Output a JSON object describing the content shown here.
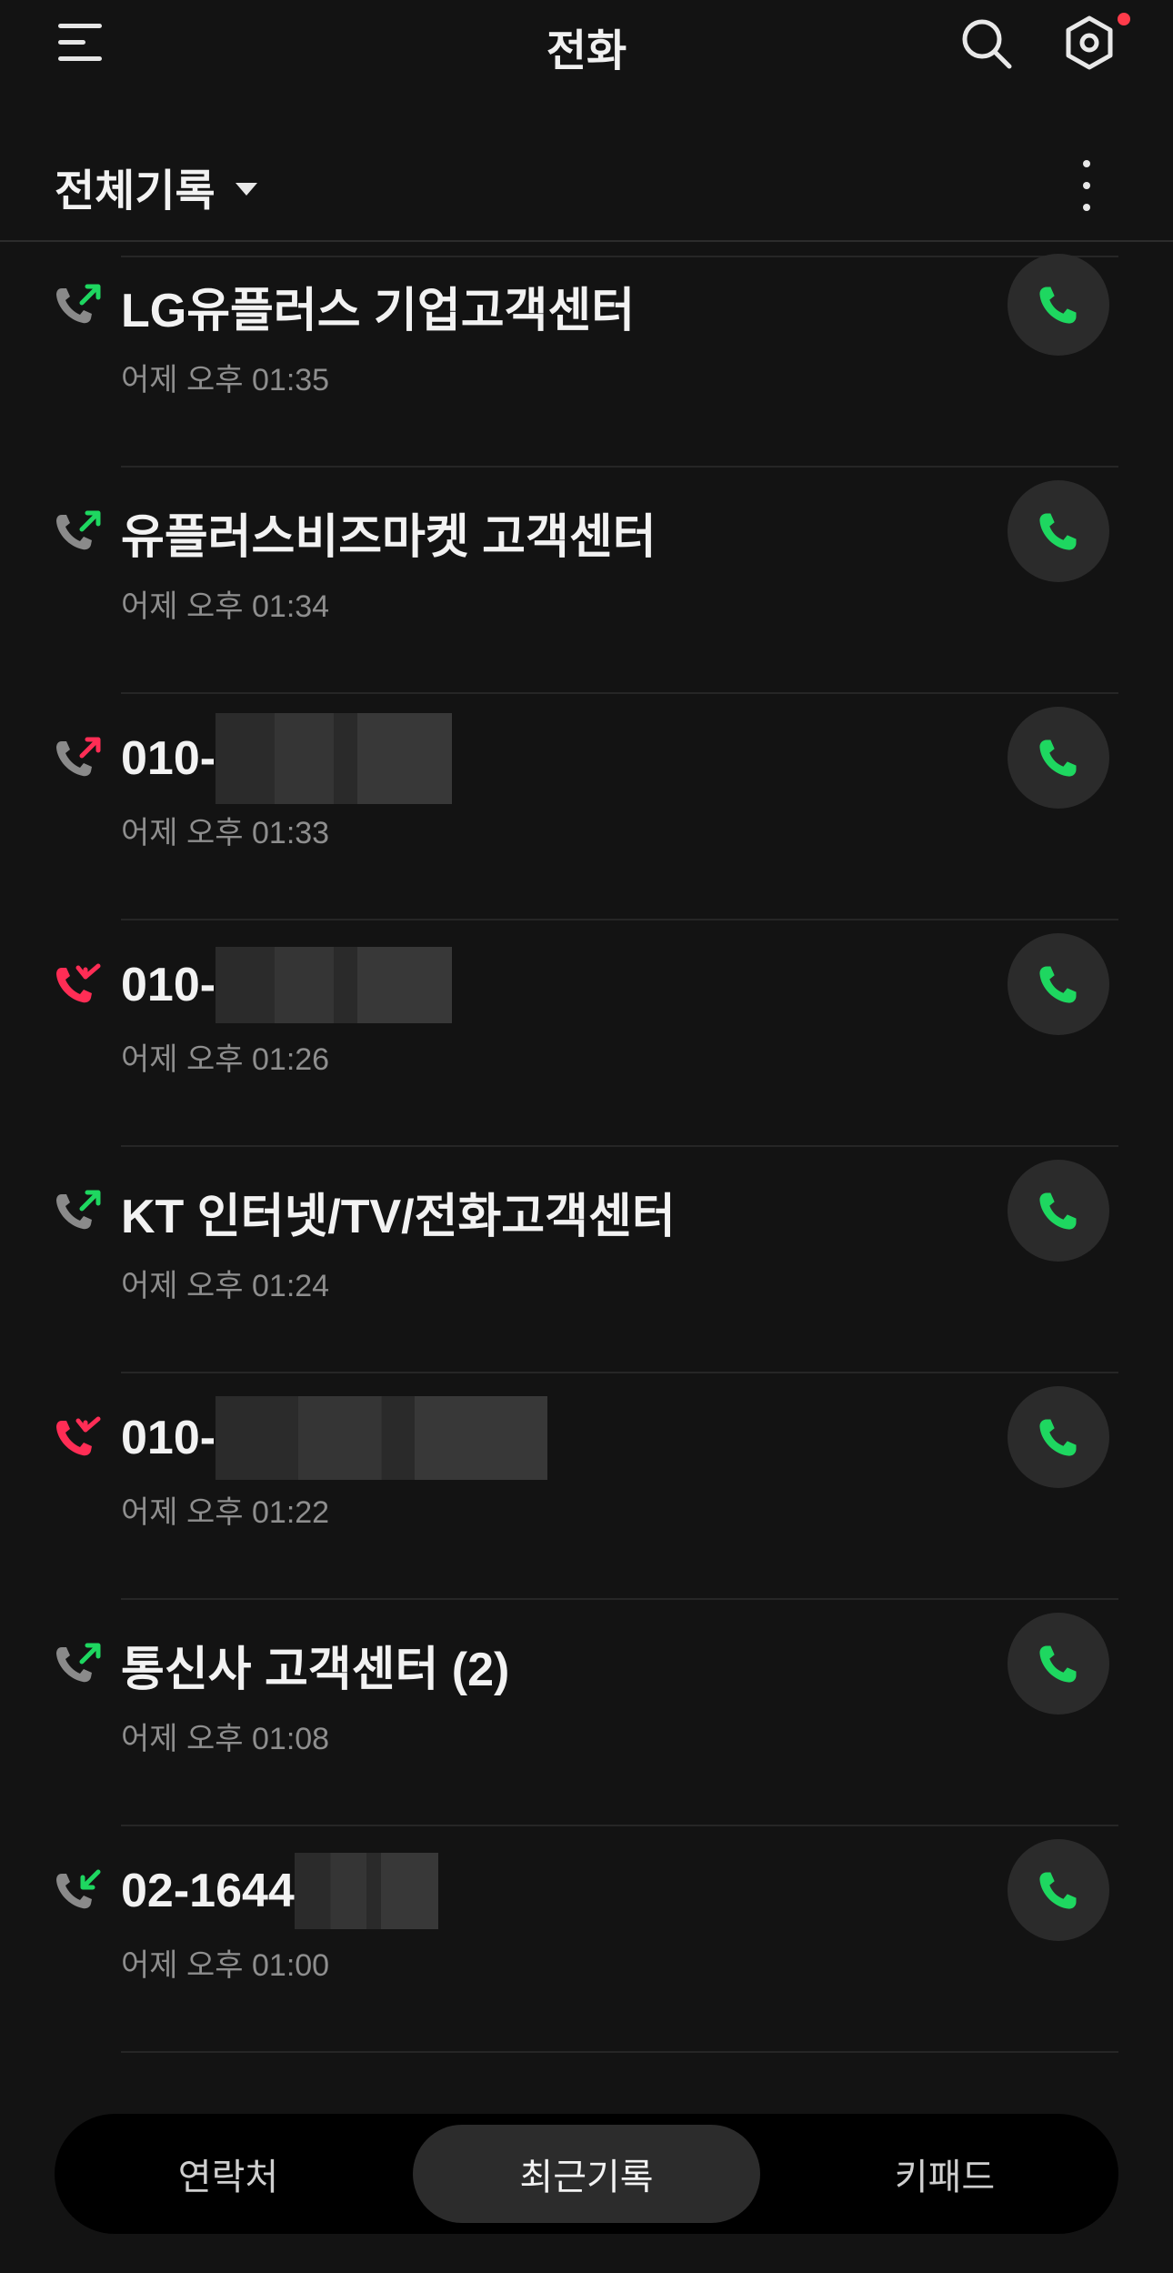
{
  "header": {
    "title": "전화"
  },
  "filter": {
    "label": "전체기록"
  },
  "calls": [
    {
      "name": "LG유플러스 기업고객센터",
      "time": "어제 오후 01:35",
      "type": "outgoing",
      "masked": false
    },
    {
      "name": "유플러스비즈마켓 고객센터",
      "time": "어제 오후 01:34",
      "type": "outgoing",
      "masked": false
    },
    {
      "name": "010-",
      "time": "어제 오후 01:33",
      "type": "outgoing-rejected",
      "masked": true
    },
    {
      "name": "010-",
      "time": "어제 오후 01:26",
      "type": "missed",
      "masked": true
    },
    {
      "name": "KT 인터넷/TV/전화고객센터",
      "time": "어제 오후 01:24",
      "type": "outgoing",
      "masked": false
    },
    {
      "name": "010-",
      "time": "어제 오후 01:22",
      "type": "missed",
      "masked": true
    },
    {
      "name": "통신사 고객센터  (2)",
      "time": "어제 오후 01:08",
      "type": "outgoing",
      "masked": false
    },
    {
      "name": "02-1644",
      "time": "어제 오후 01:00",
      "type": "incoming",
      "masked": true
    }
  ],
  "nav": {
    "tabs": [
      {
        "label": "연락처",
        "active": false
      },
      {
        "label": "최근기록",
        "active": true
      },
      {
        "label": "키패드",
        "active": false
      }
    ]
  },
  "colors": {
    "background": "#131313",
    "call_green": "#1ed760",
    "missed_red": "#ff2d55",
    "notification_dot": "#ff3b4a"
  },
  "icons": {
    "menu": "hamburger-icon",
    "search": "search-icon",
    "settings": "settings-icon",
    "more": "more-vertical-icon",
    "call": "phone-icon"
  }
}
